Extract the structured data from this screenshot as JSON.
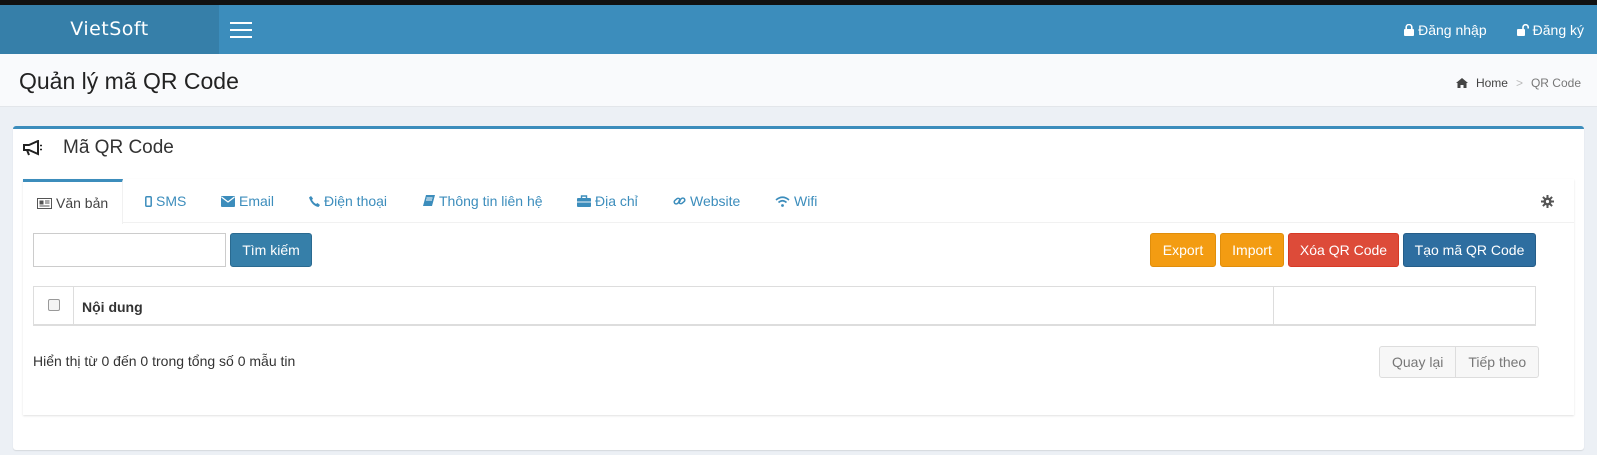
{
  "header": {
    "logo": "VietSoft",
    "login": "Đăng nhập",
    "register": "Đăng ký"
  },
  "page": {
    "title": "Quản lý mã QR Code",
    "breadcrumb": {
      "home": "Home",
      "sep": ">",
      "current": "QR Code"
    }
  },
  "box": {
    "title": "Mã QR Code",
    "tabs": [
      {
        "label": "Văn bản",
        "icon": "newspaper-icon"
      },
      {
        "label": "SMS",
        "icon": "mobile-icon"
      },
      {
        "label": "Email",
        "icon": "envelope-icon"
      },
      {
        "label": "Điện thoại",
        "icon": "phone-icon"
      },
      {
        "label": "Thông tin liên hệ",
        "icon": "book-icon"
      },
      {
        "label": "Địa chỉ",
        "icon": "briefcase-icon"
      },
      {
        "label": "Website",
        "icon": "link-icon"
      },
      {
        "label": "Wifi",
        "icon": "wifi-icon"
      }
    ],
    "toolbar": {
      "search_value": "",
      "search_button": "Tìm kiếm",
      "export": "Export",
      "import": "Import",
      "delete": "Xóa QR Code",
      "create": "Tạo mã QR Code"
    },
    "table": {
      "columns": [
        "",
        "Nội dung",
        ""
      ],
      "rows": []
    },
    "footer": {
      "info": "Hiển thị từ 0 đến 0 trong tổng số 0 mẫu tin",
      "prev": "Quay lại",
      "next": "Tiếp theo"
    }
  },
  "colors": {
    "navbar": "#3c8dbc",
    "logo_bg": "#367fa9",
    "primary_button": "#2e6ea0",
    "warning_button": "#f39c12",
    "danger_button": "#dd4b39"
  }
}
